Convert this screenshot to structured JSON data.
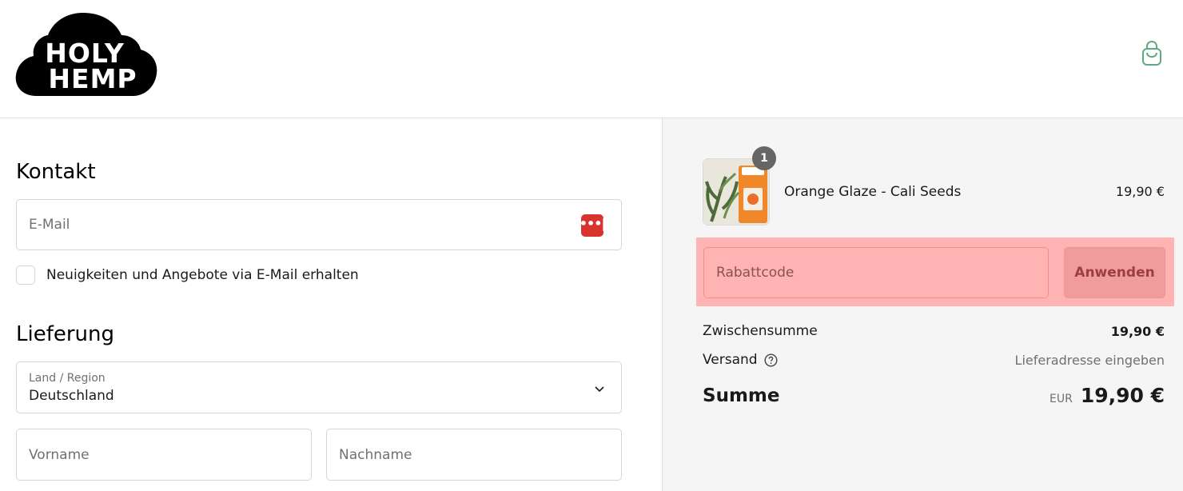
{
  "header": {
    "logo_text_line1": "HOLY",
    "logo_text_line2": "HEMP",
    "cart_icon": "shopping-bag-icon",
    "cart_icon_color": "#5fa884"
  },
  "contact": {
    "title": "Kontakt",
    "email_placeholder": "E-Mail",
    "password_manager_icon": "password-manager-icon",
    "newsletter_label": "Neuigkeiten und Angebote via E-Mail erhalten"
  },
  "delivery": {
    "title": "Lieferung",
    "country_label": "Land / Region",
    "country_value": "Deutschland",
    "firstname_placeholder": "Vorname",
    "lastname_placeholder": "Nachname"
  },
  "summary": {
    "product": {
      "name": "Orange Glaze - Cali Seeds",
      "price": "19,90 €",
      "quantity": "1"
    },
    "discount": {
      "placeholder": "Rabattcode",
      "apply_label": "Anwenden",
      "highlight_color": "#ffb3b3"
    },
    "subtotal_label": "Zwischensumme",
    "subtotal_value": "19,90 €",
    "shipping_label": "Versand",
    "shipping_value": "Lieferadresse eingeben",
    "total_label": "Summe",
    "total_currency": "EUR",
    "total_value": "19,90 €"
  }
}
